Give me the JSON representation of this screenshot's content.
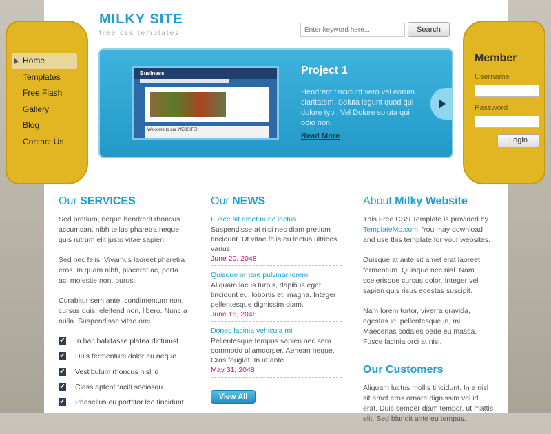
{
  "header": {
    "logo": "MILKY SITE",
    "tagline": "free css templates",
    "search_placeholder": "Enter keyword here...",
    "search_button": "Search"
  },
  "nav": {
    "items": [
      "Home",
      "Templates",
      "Free Flash",
      "Gallery",
      "Blog",
      "Contact Us"
    ],
    "active": "Home"
  },
  "member": {
    "title": "Member",
    "username_label": "Username",
    "password_label": "Password",
    "login_button": "Login"
  },
  "banner": {
    "title": "Project 1",
    "text": "Hendrerit tincidunt vero vel eorum claritatem. Soluta legunt quod qui dolore typi. Vel Dolore soluta qui odio non.",
    "read_more": "Read More",
    "thumb_title": "Business",
    "thumb_bottom": "Welcome to our WEBSITE!"
  },
  "services": {
    "title_prefix": "Our",
    "title_strong": "SERVICES",
    "paragraphs": [
      "Sed pretium, neque hendrerit rhoncus accumsan, nibh tellus pharetra neque, quis rutrum elit justo vitae sapien.",
      "Sed nec felis. Vivamus laoreet pharetra eros. In quam nibh, placerat ac, porta ac, molestie non, purus.",
      "Curabitur sem ante, condimentum non, cursus quis, eleifend non, libero. Nunc a nulla. Suspendisse vitae orci."
    ],
    "checklist": [
      "In hac habitasse platea dictumst",
      "Duis fermentum dolor eu neque",
      "Vestibulum rhoncus nisl id",
      "Class aptent taciti sociosqu",
      "Phasellus eu porttitor leo tincidunt"
    ]
  },
  "news": {
    "title_prefix": "Our",
    "title_strong": "NEWS",
    "items": [
      {
        "title": "Fusce sit amet nunc lectus",
        "body": "Suspendisse at nisi nec diam pretium tincidunt. Ut vitae felis eu lectus ultrices varius.",
        "date": "June 20, 2048"
      },
      {
        "title": "Quisque ornare pulvinar lorem",
        "body": "Aliquam lacus turpis, dapibus eget, tincidunt eu, lobortis et, magna. Integer pellentesque dignissim diam.",
        "date": "June 16, 2048"
      },
      {
        "title": "Donec lacinia vehicula mi",
        "body": "Pellentesque tempus sapien nec sem commodo ullamcorper. Aenean neque. Cras feugiat. In ut ante.",
        "date": "May 31, 2048"
      }
    ],
    "view_all": "View All"
  },
  "about": {
    "title_prefix": "About",
    "title_strong": "Milky Website",
    "p1_a": "This Free CSS Template is provided by ",
    "p1_link": "TemplateMo.com",
    "p1_b": ". You may download and use this template for your websites.",
    "p2": "Quisque at ante sit amet erat laoreet fermentum. Quisque nec nisl. Nam scelerisque cursus dolor. Integer vel sapien quis risus egestas suscipit.",
    "p3": "Nam lorem tortor, viverra gravida, egestas id, pellentesque in, mi. Maecenas sodales pede eu massa. Fusce lacinia orci at nisi."
  },
  "customers": {
    "title": "Our Customers",
    "text": "Aliquam luctus mollis tincidunt. In a nisl sit amet eros ornare dignissim vel id erat. Duis semper diam tempor, ut mattis elit. Sed blandit ante eu tempus."
  }
}
